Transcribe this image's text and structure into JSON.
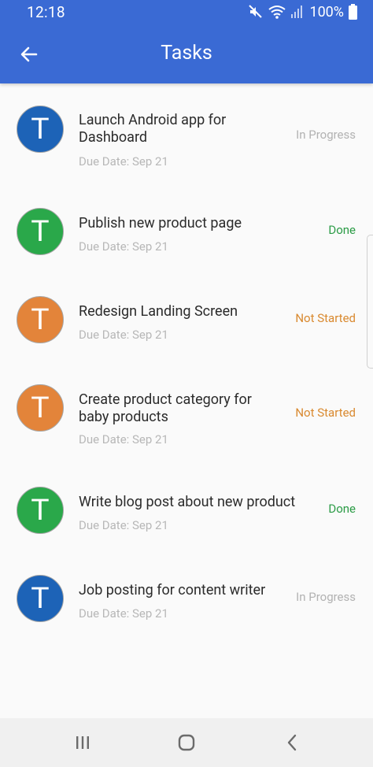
{
  "status_bar": {
    "time": "12:18",
    "battery": "100%",
    "icons": [
      "mute-icon",
      "wifi-icon",
      "signal-icon",
      "battery-icon"
    ]
  },
  "app_bar": {
    "title": "Tasks",
    "back_icon": "arrow-left-icon"
  },
  "colors": {
    "app_bar": "#3a6ad4",
    "avatar_blue": "#1d63b7",
    "avatar_green": "#2aa84a",
    "avatar_orange": "#e3843a",
    "status_in_progress": "#b2b2b2",
    "status_done": "#2a9b45",
    "status_not_started": "#d9892f"
  },
  "tasks": [
    {
      "initial": "T",
      "title": "Launch Android app for Dashboard",
      "due": "Due Date: Sep 21",
      "status": "In Progress",
      "avatar_color": "#1d63b7",
      "status_color": "#b2b2b2"
    },
    {
      "initial": "T",
      "title": "Publish new product page",
      "due": "Due Date: Sep 21",
      "status": "Done",
      "avatar_color": "#2aa84a",
      "status_color": "#2a9b45"
    },
    {
      "initial": "T",
      "title": "Redesign Landing Screen",
      "due": "Due Date: Sep 21",
      "status": "Not Started",
      "avatar_color": "#e3843a",
      "status_color": "#d9892f"
    },
    {
      "initial": "T",
      "title": "Create product category for baby products",
      "due": "Due Date: Sep 21",
      "status": "Not Started",
      "avatar_color": "#e3843a",
      "status_color": "#d9892f"
    },
    {
      "initial": "T",
      "title": "Write blog post about new product",
      "due": "Due Date: Sep 21",
      "status": "Done",
      "avatar_color": "#2aa84a",
      "status_color": "#2a9b45"
    },
    {
      "initial": "T",
      "title": "Job posting for content writer",
      "due": "Due Date: Sep 21",
      "status": "In Progress",
      "avatar_color": "#1d63b7",
      "status_color": "#b2b2b2"
    }
  ],
  "nav_bar": {
    "icons": [
      "recent-apps-icon",
      "home-icon",
      "back-icon"
    ]
  }
}
